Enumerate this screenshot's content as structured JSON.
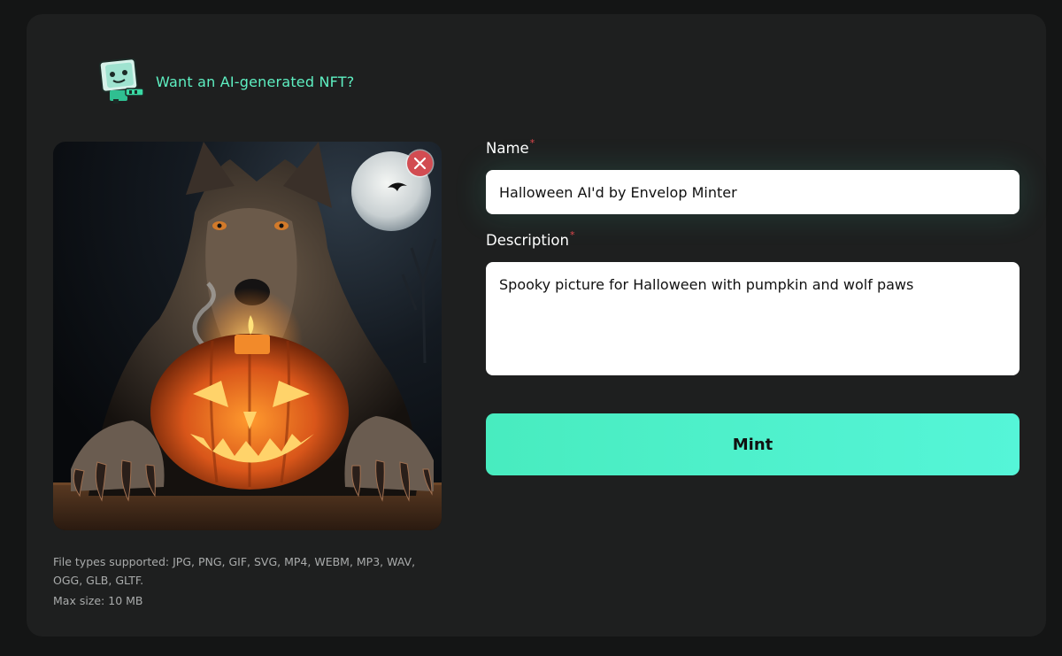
{
  "promo": {
    "text": "Want an AI-generated NFT?",
    "icon": "robot-icon",
    "color": "#5ef0c2"
  },
  "upload": {
    "preview_alt": "Wolf with jack-o'-lantern and full moon",
    "remove_icon": "close-icon",
    "file_types": "File types supported: JPG, PNG, GIF, SVG, MP4, WEBM, MP3, WAV, OGG, GLB, GLTF.",
    "max_size": "Max size: 10 MB"
  },
  "form": {
    "name_label": "Name",
    "name_value": "Halloween AI'd by Envelop Minter",
    "description_label": "Description",
    "description_value": "Spooky picture for Halloween with pumpkin and wolf paws",
    "required_marker": "*",
    "submit_label": "Mint"
  },
  "colors": {
    "accent": "#4df0c8",
    "background": "#141515",
    "card": "#1e1f1f",
    "required": "#e0474c",
    "remove": "#d24c52"
  }
}
